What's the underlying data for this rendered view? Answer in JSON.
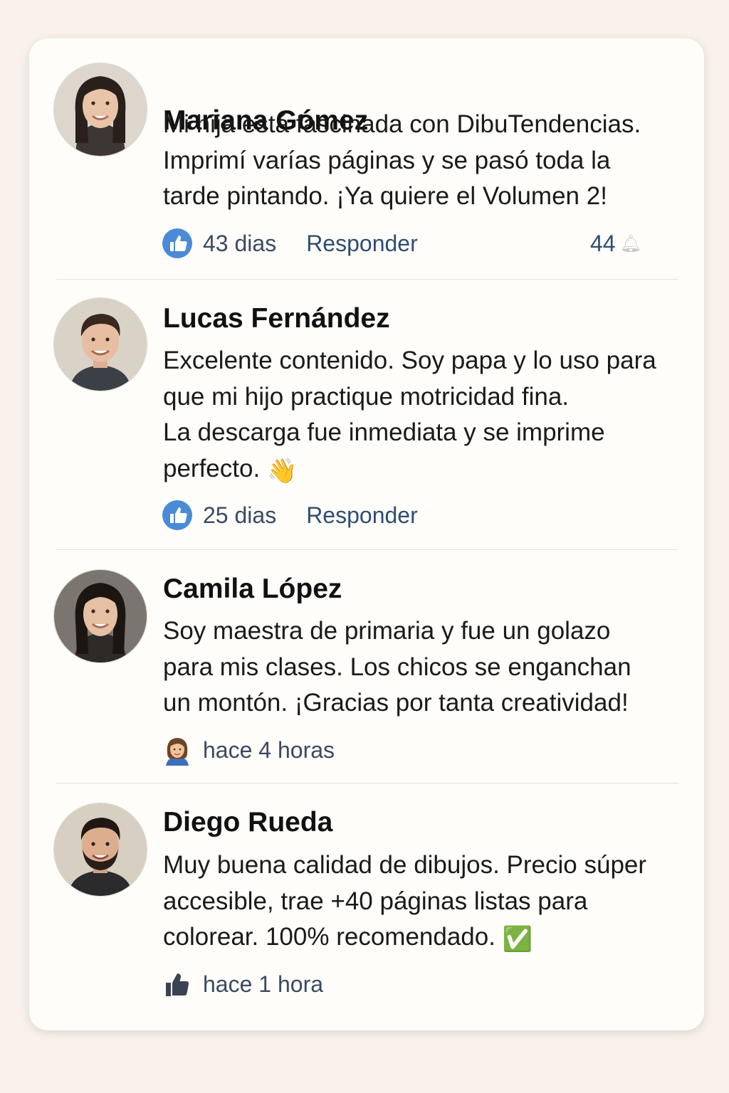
{
  "comments": [
    {
      "name": "Mariana Gómez",
      "lines": [
        "Mi hija está fascinada con DibuTendencias.",
        "Imprimí varías páginas y se pasó toda la",
        "tarde pintando. ¡Ya quiere el Volumen 2!"
      ],
      "reaction_icon": "thumbs-up-blue-icon",
      "time": "43 dias",
      "reply": "Responder",
      "count": "44"
    },
    {
      "name": "Lucas Fernández",
      "lines": [
        "Excelente contenido. Soy papa y lo uso para",
        "que mi hijo practique motricidad fina.",
        "La descarga fue inmediata y se imprime",
        "perfecto."
      ],
      "emoji": "👋",
      "reaction_icon": "thumbs-up-blue-icon",
      "time": "25 dias",
      "reply": "Responder"
    },
    {
      "name": "Camila López",
      "lines": [
        "Soy maestra de primaria y fue un golazo",
        "para mis clases. Los chicos se enganchan",
        "un montón. ¡Gracias por tanta creatividad!"
      ],
      "reaction_icon": "woman-emoji-icon",
      "time": "hace 4 horas"
    },
    {
      "name": "Diego Rueda",
      "lines": [
        "Muy buena calidad de dibujos. Precio súper",
        "accesible, trae +40 páginas listas para",
        "colorear. 100% recomendado."
      ],
      "emoji": "✅",
      "reaction_icon": "thumbs-up-dark-icon",
      "time": "hace 1 hora"
    }
  ],
  "colors": {
    "page_background": "#f8f2ea",
    "card_background": "#fffdfa",
    "like_blue": "#4a8ad6",
    "meta_text": "#3a4a63",
    "check_green": "#5cc845"
  }
}
